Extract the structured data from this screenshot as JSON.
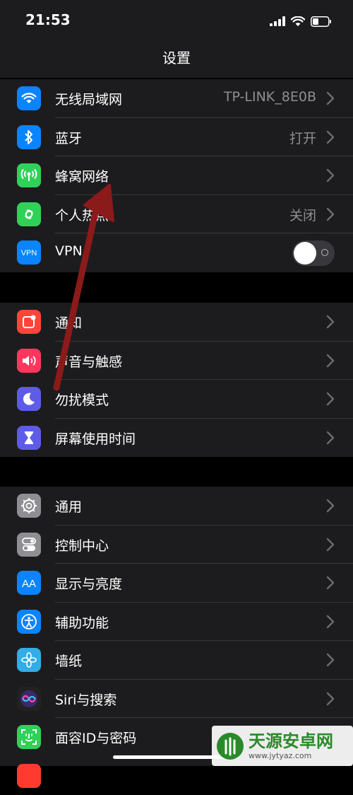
{
  "status_bar": {
    "time": "21:53"
  },
  "nav": {
    "title": "设置"
  },
  "group1": [
    {
      "label": "无线局域网",
      "value": "TP-LINK_8E0B",
      "icon": "wifi-icon",
      "color": "#0a84ff"
    },
    {
      "label": "蓝牙",
      "value": "打开",
      "icon": "bluetooth-icon",
      "color": "#0a84ff"
    },
    {
      "label": "蜂窝网络",
      "value": "",
      "icon": "cellular-icon",
      "color": "#30d158"
    },
    {
      "label": "个人热点",
      "value": "关闭",
      "icon": "hotspot-icon",
      "color": "#30d158"
    },
    {
      "label": "VPN",
      "value": "",
      "icon": "vpn-icon",
      "color": "#0a84ff",
      "toggle": false
    }
  ],
  "group2": [
    {
      "label": "通知",
      "icon": "notifications-icon",
      "color": "#ff453a"
    },
    {
      "label": "声音与触感",
      "icon": "sound-icon",
      "color": "#ff375f"
    },
    {
      "label": "勿扰模式",
      "icon": "moon-icon",
      "color": "#5e5ce6"
    },
    {
      "label": "屏幕使用时间",
      "icon": "hourglass-icon",
      "color": "#5e5ce6"
    }
  ],
  "group3": [
    {
      "label": "通用",
      "icon": "gear-icon",
      "color": "#8e8e93"
    },
    {
      "label": "控制中心",
      "icon": "control-center-icon",
      "color": "#8e8e93"
    },
    {
      "label": "显示与亮度",
      "icon": "display-icon",
      "color": "#0a84ff"
    },
    {
      "label": "辅助功能",
      "icon": "accessibility-icon",
      "color": "#0a84ff"
    },
    {
      "label": "墙纸",
      "icon": "wallpaper-icon",
      "color": "#32ade6"
    },
    {
      "label": "Siri与搜索",
      "icon": "siri-icon",
      "color": "#222"
    },
    {
      "label": "面容ID与密码",
      "icon": "faceid-icon",
      "color": "#30d158"
    }
  ],
  "watermark": {
    "title": "天源安卓网",
    "url": "www.jytyaz.com"
  }
}
